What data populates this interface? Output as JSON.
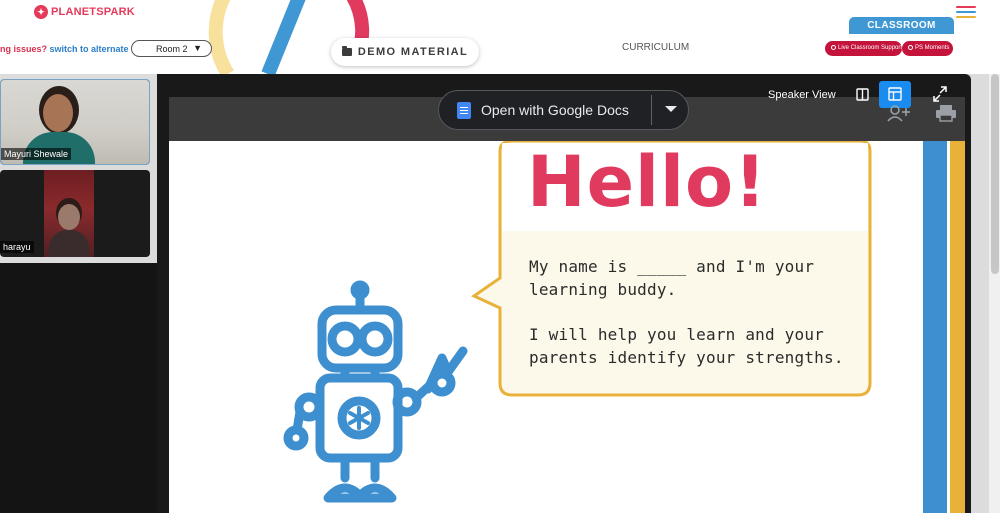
{
  "header": {
    "logo_text": "PLANETSPARK",
    "issues_prefix": "ng issues?",
    "alternate_link": "switch to alternate room",
    "room_value": "Room 2",
    "demo_material_label": "DEMO MATERIAL",
    "curriculum_label": "CURRICULUM",
    "classroom_tab": "CLASSROOM",
    "live_support_label": "Live Classroom Support",
    "ps_moments_label": "PS Moments"
  },
  "participants": [
    {
      "name": "Mayuri Shewale"
    },
    {
      "name": "harayu"
    }
  ],
  "viewer": {
    "open_with_label": "Open with Google Docs",
    "speaker_view_label": "Speaker View"
  },
  "slide": {
    "heading": "Hello!",
    "line1": "My name is _____ and I'm your",
    "line2": "learning buddy.",
    "line3": "I will help you learn and your",
    "line4": "parents identify your strengths."
  },
  "colors": {
    "brand_red": "#e53a5a",
    "accent_blue": "#3f97d4",
    "pill_red": "#c4143b",
    "slide_pink": "#e03a5e",
    "robot_blue": "#3d8fcf",
    "bubble_fill": "#fcf8ea",
    "bubble_stroke": "#e8b23a",
    "stripe_yellow": "#e8b23a"
  },
  "icons": [
    "menu-icon",
    "folder-icon",
    "google-docs-icon",
    "split-view-icon",
    "layout-icon",
    "expand-icon",
    "add-person-icon",
    "print-icon",
    "robot-illustration"
  ]
}
